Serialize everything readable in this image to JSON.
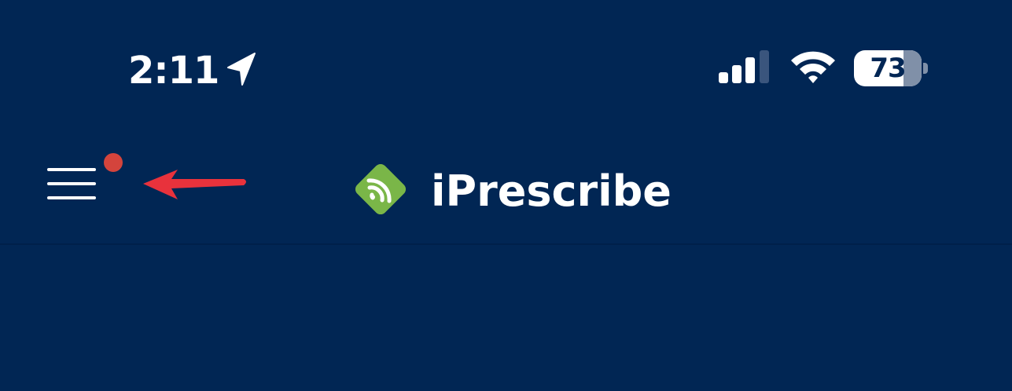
{
  "status_bar": {
    "time": "2:11",
    "location_icon": "location-arrow-icon",
    "signal_icon": "cellular-signal-icon",
    "wifi_icon": "wifi-icon",
    "battery_level": 73,
    "battery_text": "73"
  },
  "nav_bar": {
    "menu_icon": "hamburger-menu-icon",
    "has_notification": true,
    "app_title": "iPrescribe",
    "logo_icon": "iprescribe-logo-icon"
  },
  "colors": {
    "background": "#012654",
    "logo_green": "#7ab648",
    "notification_red": "#d4443c",
    "annotation_arrow": "#e8323c"
  }
}
